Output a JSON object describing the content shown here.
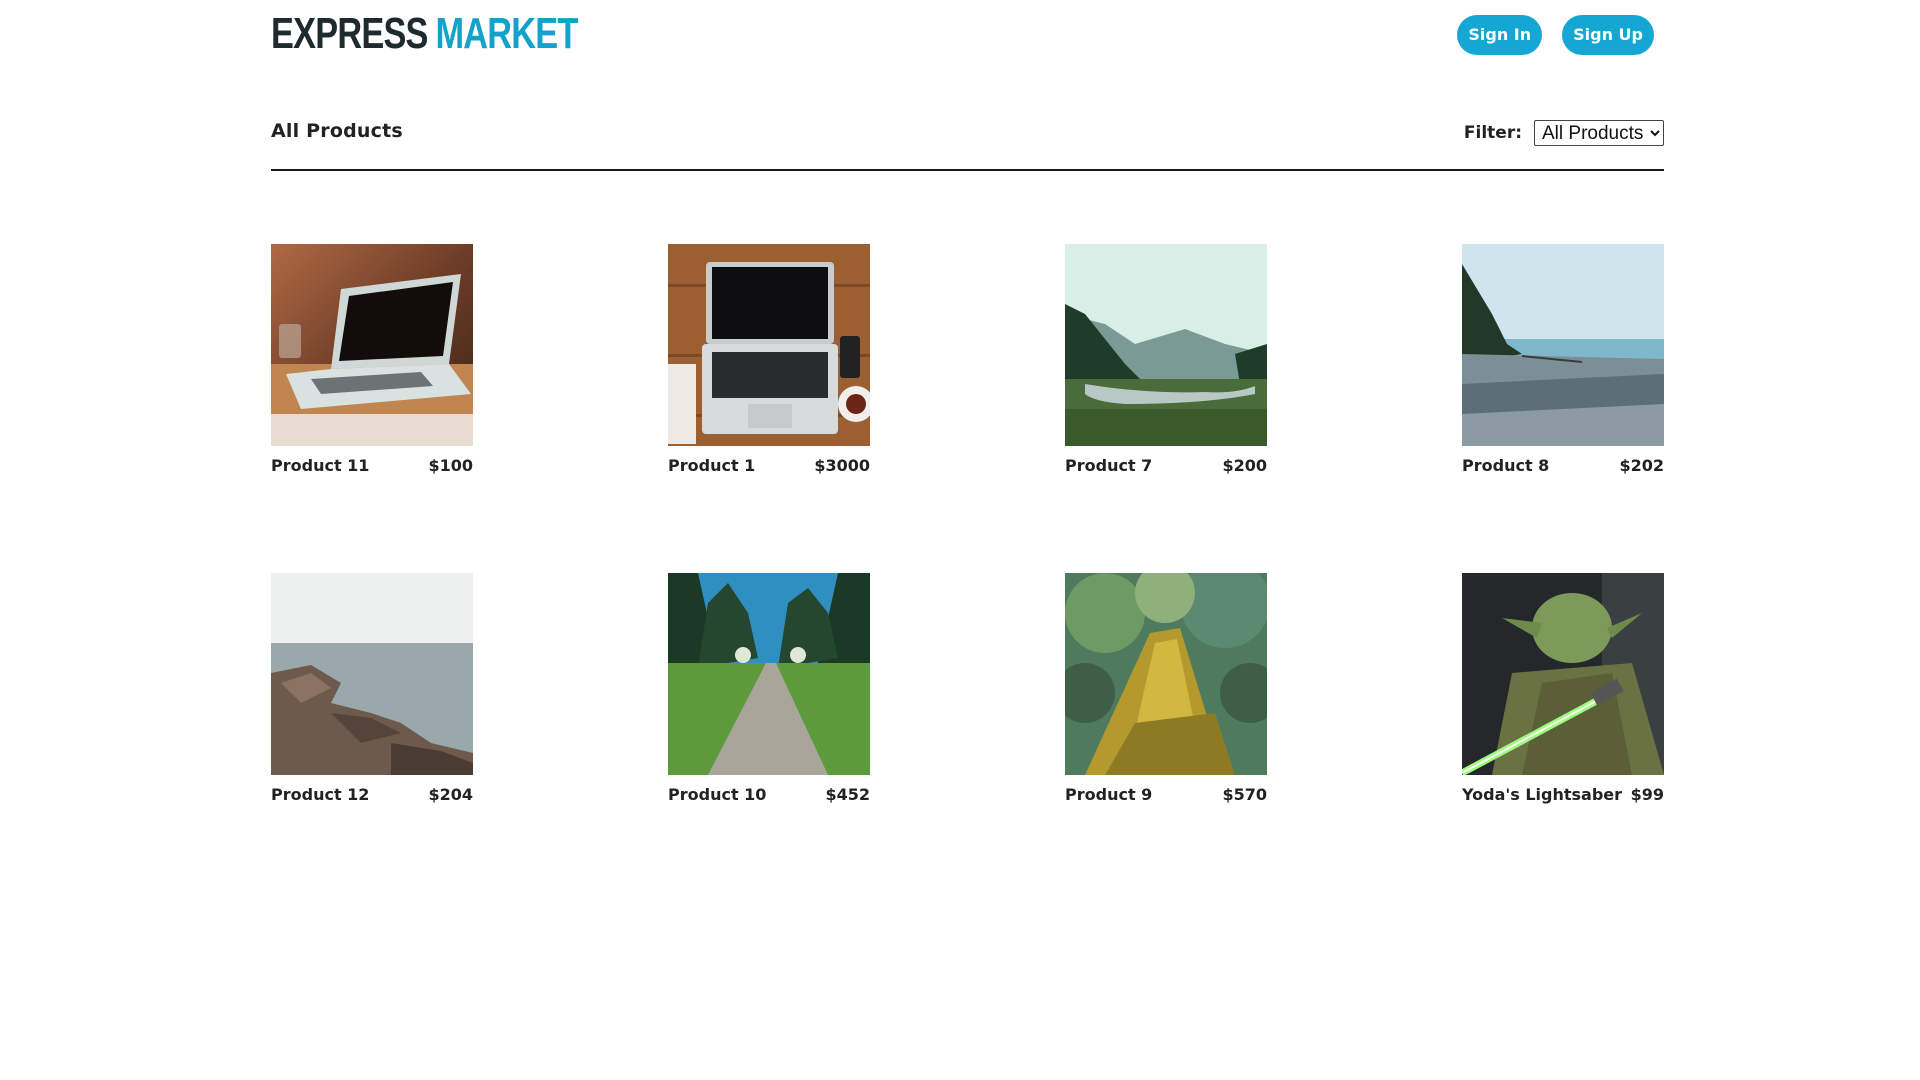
{
  "brand": {
    "part1": "EXPRESS",
    "part2": "MARKET",
    "color_dark": "#1f2a30",
    "color_accent": "#13a2c9"
  },
  "auth": {
    "sign_in_label": "Sign In",
    "sign_up_label": "Sign Up",
    "button_color": "#15a7d3"
  },
  "toolbar": {
    "title": "All Products",
    "filter_label": "Filter:",
    "filter_selected": "All Products"
  },
  "products": [
    {
      "name": "Product 11",
      "price": "$100",
      "image": "laptop-photo"
    },
    {
      "name": "Product 1",
      "price": "$3000",
      "image": "laptop-desk-photo"
    },
    {
      "name": "Product 7",
      "price": "$200",
      "image": "river-valley-photo"
    },
    {
      "name": "Product 8",
      "price": "$202",
      "image": "beach-shore-photo"
    },
    {
      "name": "Product 12",
      "price": "$204",
      "image": "rocky-coast-photo"
    },
    {
      "name": "Product 10",
      "price": "$452",
      "image": "forest-path-photo"
    },
    {
      "name": "Product 9",
      "price": "$570",
      "image": "mossy-log-photo"
    },
    {
      "name": "Yoda's Lightsaber",
      "price": "$99",
      "image": "yoda-lightsaber-photo"
    }
  ]
}
